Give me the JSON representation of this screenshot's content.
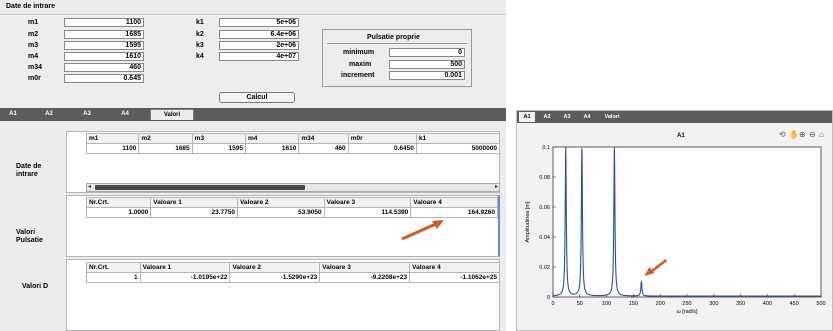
{
  "left_window": {
    "title": "Date de intrare",
    "inputs_left": [
      {
        "label": "m1",
        "value": "1100"
      },
      {
        "label": "m2",
        "value": "1685"
      },
      {
        "label": "m3",
        "value": "1595"
      },
      {
        "label": "m4",
        "value": "1610"
      },
      {
        "label": "m34",
        "value": "460"
      },
      {
        "label": "m0r",
        "value": "0.645"
      }
    ],
    "inputs_k": [
      {
        "label": "k1",
        "value": "5e+06"
      },
      {
        "label": "k2",
        "value": "6.4e+06"
      },
      {
        "label": "k3",
        "value": "2e+06"
      },
      {
        "label": "k4",
        "value": "4e+07"
      }
    ],
    "pulsatie": {
      "title": "Pulsatie proprie",
      "minim_label": "minimum",
      "minim_value": "0",
      "maxim_label": "maxim",
      "maxim_value": "500",
      "increment_label": "increment",
      "increment_value": "0.001"
    },
    "calcul_label": "Calcul",
    "tabs": [
      "A1",
      "A2",
      "A3",
      "A4",
      "Valori"
    ],
    "date_intrare_label": "Date de intrare",
    "input_table": {
      "headers": [
        "m1",
        "m2",
        "m3",
        "m4",
        "m34",
        "m0r",
        "k1"
      ],
      "values": [
        "1100",
        "1685",
        "1595",
        "1610",
        "460",
        "0.6450",
        "5000000"
      ]
    },
    "scroll_left": "◂",
    "scroll_right": "▸",
    "valori_pulsatie_label": "Valori Pulsatie",
    "pulsatie_table": {
      "headers": [
        "Nr.Crt.",
        "Valoare 1",
        "Valoare 2",
        "Valoare 3",
        "Valoare 4"
      ],
      "values": [
        "1.0000",
        "23.7750",
        "53.9050",
        "114.5390",
        "164.9260"
      ]
    },
    "valori_d_label": "Valori D",
    "d_table": {
      "headers": [
        "Nr.Crt.",
        "Valoare 1",
        "Valoare 2",
        "Valoare 3",
        "Valoare 4"
      ],
      "values": [
        "1",
        "-1.0195e+22",
        "-1.5290e+23",
        "-9.2208e+23",
        "-1.1062e+25"
      ]
    }
  },
  "right_window": {
    "tabs": [
      "A1",
      "A2",
      "A3",
      "A4",
      "Valori"
    ],
    "toolbar_icons": [
      "rotate-icon",
      "pan-icon",
      "zoom-in-icon",
      "zoom-out-icon",
      "home-icon"
    ],
    "chart_data": {
      "type": "line",
      "title": "A1",
      "xlabel": "ω [rad/s]",
      "ylabel": "Amplitudinea [m]",
      "xlim": [
        0,
        500
      ],
      "ylim": [
        0,
        0.1
      ],
      "x_ticks": [
        "0",
        "50",
        "100",
        "150",
        "200",
        "250",
        "300",
        "350",
        "400",
        "450",
        "500"
      ],
      "y_ticks": [
        "0",
        "0.02",
        "0.04",
        "0.06",
        "0.08",
        "0.1"
      ],
      "resonance_peaks": [
        23.775,
        53.905,
        114.539,
        164.926
      ],
      "peak_heights": [
        0.1,
        0.1,
        0.1,
        0.01
      ],
      "line_color": "#2b4f9a",
      "arrow_color": "#d9581e"
    }
  }
}
